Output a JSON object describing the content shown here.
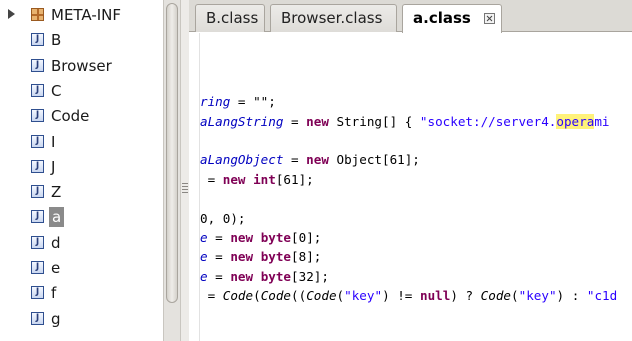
{
  "tree": {
    "items": [
      {
        "label": "META-INF",
        "kind": "package",
        "icon": "package-icon",
        "expandable": true
      },
      {
        "label": "B",
        "kind": "class",
        "icon": "java-class-icon"
      },
      {
        "label": "Browser",
        "kind": "class",
        "icon": "java-class-icon"
      },
      {
        "label": "C",
        "kind": "class",
        "icon": "java-class-icon"
      },
      {
        "label": "Code",
        "kind": "class",
        "icon": "java-class-icon"
      },
      {
        "label": "I",
        "kind": "class",
        "icon": "java-class-icon"
      },
      {
        "label": "J",
        "kind": "class",
        "icon": "java-class-icon"
      },
      {
        "label": "Z",
        "kind": "class",
        "icon": "java-class-icon"
      },
      {
        "label": "a",
        "kind": "class",
        "icon": "java-class-icon",
        "selected": true
      },
      {
        "label": "d",
        "kind": "class",
        "icon": "java-class-icon"
      },
      {
        "label": "e",
        "kind": "class",
        "icon": "java-class-icon"
      },
      {
        "label": "f",
        "kind": "class",
        "icon": "java-class-icon"
      },
      {
        "label": "g",
        "kind": "class",
        "icon": "java-class-icon"
      }
    ],
    "java_icon_glyph": "J"
  },
  "tabs": [
    {
      "label": "B.class",
      "active": false
    },
    {
      "label": "Browser.class",
      "active": false
    },
    {
      "label": "a.class",
      "active": true,
      "closable": true
    }
  ],
  "code": {
    "lines": [
      {
        "row": 0,
        "tokens": [
          {
            "t": "ring",
            "c": "fld"
          },
          {
            "t": " = \"\";",
            "c": ""
          }
        ]
      },
      {
        "row": 1,
        "tokens": [
          {
            "t": "aLangString",
            "c": "fld"
          },
          {
            "t": " = ",
            "c": ""
          },
          {
            "t": "new",
            "c": "kw"
          },
          {
            "t": " String[] { ",
            "c": ""
          },
          {
            "t": "\"socket://server4.",
            "c": "str"
          },
          {
            "t": "opera",
            "c": "str hl"
          },
          {
            "t": "mi",
            "c": "str"
          }
        ]
      },
      {
        "row": 3,
        "tokens": [
          {
            "t": "aLangObject",
            "c": "fld"
          },
          {
            "t": " = ",
            "c": ""
          },
          {
            "t": "new",
            "c": "kw"
          },
          {
            "t": " Object[61];",
            "c": ""
          }
        ]
      },
      {
        "row": 4,
        "tokens": [
          {
            "t": " = ",
            "c": ""
          },
          {
            "t": "new",
            "c": "kw"
          },
          {
            "t": " ",
            "c": ""
          },
          {
            "t": "int",
            "c": "kw"
          },
          {
            "t": "[61];",
            "c": ""
          }
        ]
      },
      {
        "row": 6,
        "tokens": [
          {
            "t": "0, 0);",
            "c": ""
          }
        ]
      },
      {
        "row": 7,
        "tokens": [
          {
            "t": "e",
            "c": "fld"
          },
          {
            "t": " = ",
            "c": ""
          },
          {
            "t": "new",
            "c": "kw"
          },
          {
            "t": " ",
            "c": ""
          },
          {
            "t": "byte",
            "c": "kw"
          },
          {
            "t": "[0];",
            "c": ""
          }
        ]
      },
      {
        "row": 8,
        "tokens": [
          {
            "t": "e",
            "c": "fld"
          },
          {
            "t": " = ",
            "c": ""
          },
          {
            "t": "new",
            "c": "kw"
          },
          {
            "t": " ",
            "c": ""
          },
          {
            "t": "byte",
            "c": "kw"
          },
          {
            "t": "[8];",
            "c": ""
          }
        ]
      },
      {
        "row": 9,
        "tokens": [
          {
            "t": "e",
            "c": "fld"
          },
          {
            "t": " = ",
            "c": ""
          },
          {
            "t": "new",
            "c": "kw"
          },
          {
            "t": " ",
            "c": ""
          },
          {
            "t": "byte",
            "c": "kw"
          },
          {
            "t": "[32];",
            "c": ""
          }
        ]
      },
      {
        "row": 10,
        "tokens": [
          {
            "t": " = ",
            "c": ""
          },
          {
            "t": "Code",
            "c": "mth"
          },
          {
            "t": "(",
            "c": ""
          },
          {
            "t": "Code",
            "c": "mth"
          },
          {
            "t": "((",
            "c": ""
          },
          {
            "t": "Code",
            "c": "mth"
          },
          {
            "t": "(",
            "c": ""
          },
          {
            "t": "\"key\"",
            "c": "str"
          },
          {
            "t": ") != ",
            "c": ""
          },
          {
            "t": "null",
            "c": "kw"
          },
          {
            "t": ") ? ",
            "c": ""
          },
          {
            "t": "Code",
            "c": "mth"
          },
          {
            "t": "(",
            "c": ""
          },
          {
            "t": "\"key\"",
            "c": "str"
          },
          {
            "t": ") : ",
            "c": ""
          },
          {
            "t": "\"c1d",
            "c": "str"
          }
        ]
      }
    ]
  },
  "colors": {
    "keyword": "#7f0055",
    "field": "#0000c0",
    "string": "#2a00ff",
    "search_highlight": "#fff27a",
    "selection": "#8a8a8a"
  }
}
